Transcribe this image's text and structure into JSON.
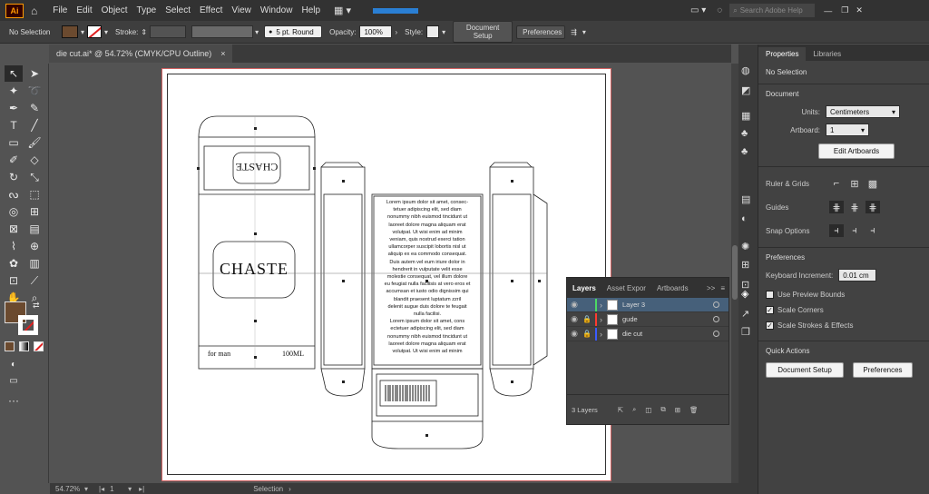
{
  "menubar": {
    "logo": "Ai",
    "items": [
      "File",
      "Edit",
      "Object",
      "Type",
      "Select",
      "Effect",
      "View",
      "Window",
      "Help"
    ],
    "search_placeholder": "Search Adobe Help"
  },
  "control_bar": {
    "selection_label": "No Selection",
    "fill_color": "#6b4a2f",
    "stroke_label": "Stroke:",
    "brush_label": "5 pt. Round",
    "opacity_label": "Opacity:",
    "opacity_value": "100%",
    "style_label": "Style:",
    "document_setup": "Document Setup",
    "preferences": "Preferences"
  },
  "document": {
    "tab_title": "die cut.ai* @ 54.72% (CMYK/CPU Outline)",
    "close": "×"
  },
  "artwork": {
    "brand_top": "CHASTE",
    "brand_main": "CHASTE",
    "bottom_left": "for man",
    "bottom_right": "100ML",
    "lorem_lines": [
      "Lorem ipsum dolor sit amet, consec-",
      "tetuer adipiscing elit, sed diam",
      "nonummy nibh euismod tincidunt ut",
      "laoreet dolore magna aliquam erat",
      "volutpat. Ut wisi enim ad minim",
      "veniam, quis nostrud exerci tation",
      "ullamcorper suscipit lobortis nisl ut",
      "aliquip ex ea commodo consequat.",
      "Duis autem vel eum iriure dolor in",
      "hendrerit in vulputate velit esse",
      "molestie consequat, vel illum dolore",
      "eu feugiat nulla facilisis at vero eros et",
      "accumsan et iusto odio dignissim qui",
      "blandit praesent luptatum zzril",
      "delenit augue duis dolore te feugait",
      "nulla facilisi.",
      "Lorem ipsum dolor sit amet, cons",
      "ectetuer adipiscing elit, sed diam",
      "nonummy nibh euismod tincidunt ut",
      "laoreet dolore magna aliquam erat",
      "volutpat. Ut wisi enim ad minim"
    ]
  },
  "status": {
    "zoom": "54.72%",
    "artboard": "1",
    "tool": "Selection"
  },
  "properties": {
    "tabs": [
      "Properties",
      "Libraries"
    ],
    "selection": "No Selection",
    "document_header": "Document",
    "units_label": "Units:",
    "units_value": "Centimeters",
    "artboard_label": "Artboard:",
    "artboard_value": "1",
    "edit_artboards": "Edit Artboards",
    "rulers_grids": "Ruler & Grids",
    "guides": "Guides",
    "snap_options": "Snap Options",
    "preferences_header": "Preferences",
    "keyboard_increment_label": "Keyboard Increment:",
    "keyboard_increment_value": "0.01 cm",
    "use_preview_bounds": "Use Preview Bounds",
    "scale_corners": "Scale Corners",
    "scale_strokes": "Scale Strokes & Effects",
    "quick_actions": "Quick Actions",
    "document_setup_btn": "Document Setup",
    "preferences_btn": "Preferences"
  },
  "layers_panel": {
    "tabs": [
      "Layers",
      "Asset Expor",
      "Artboards"
    ],
    "more": ">>",
    "layers": [
      {
        "name": "Layer 3",
        "color": "#4cd964",
        "selected": true,
        "locked": false
      },
      {
        "name": "gude",
        "color": "#ff3b30",
        "selected": false,
        "locked": true
      },
      {
        "name": "die cut",
        "color": "#3b5cff",
        "selected": false,
        "locked": true
      }
    ],
    "count": "3 Layers"
  }
}
